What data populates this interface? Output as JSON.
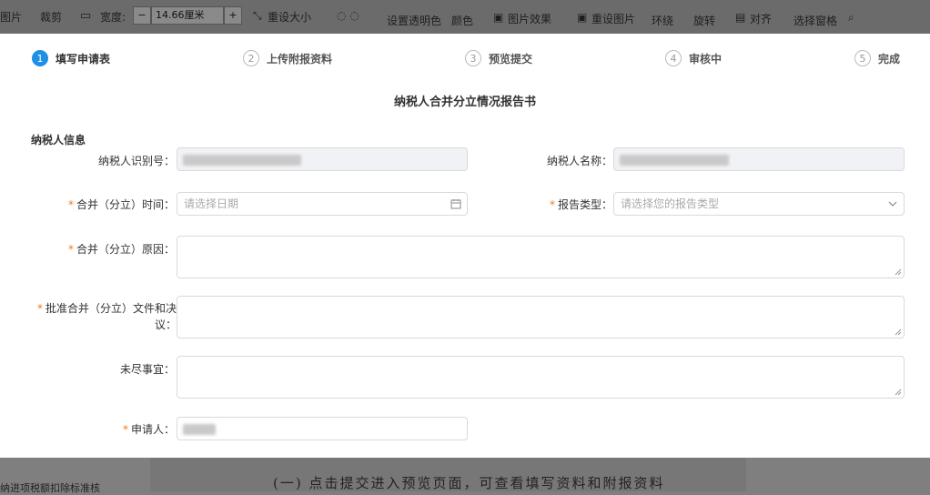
{
  "toolbar": {
    "pic": "图片",
    "crop": "裁剪",
    "width_label": "宽度:",
    "minus": "−",
    "width_value": "14.66厘米",
    "plus": "+",
    "reset_size": "重设大小",
    "set_transparent": "设置透明色",
    "color": "颜色",
    "pic_effect": "图片效果",
    "reset_pic": "重设图片",
    "wrap": "环绕",
    "rotate": "旋转",
    "align": "对齐",
    "select_pane": "选择窗格"
  },
  "steps": [
    {
      "num": "1",
      "label": "填写申请表"
    },
    {
      "num": "2",
      "label": "上传附报资料"
    },
    {
      "num": "3",
      "label": "预览提交"
    },
    {
      "num": "4",
      "label": "审核中"
    },
    {
      "num": "5",
      "label": "完成"
    }
  ],
  "form": {
    "title": "纳税人合并分立情况报告书",
    "section": "纳税人信息",
    "taxpayer_id_label": "纳税人识别号：",
    "taxpayer_name_label": "纳税人名称：",
    "required_mark": "*",
    "merge_time_label": "合并（分立）时间：",
    "merge_time_placeholder": "请选择日期",
    "report_type_label": "报告类型：",
    "report_type_placeholder": "请选择您的报告类型",
    "reason_label": "合并（分立）原因：",
    "approval_label_1": "批准合并（分立）文件和决",
    "approval_label_2": "议：",
    "pending_label": "未尽事宜：",
    "applicant_label": "申请人："
  },
  "background": {
    "doc_text": "(一) 点击提交进入预览页面，可查看填写资料和附报资料",
    "left_text": "纳进项税额扣除标准核"
  }
}
